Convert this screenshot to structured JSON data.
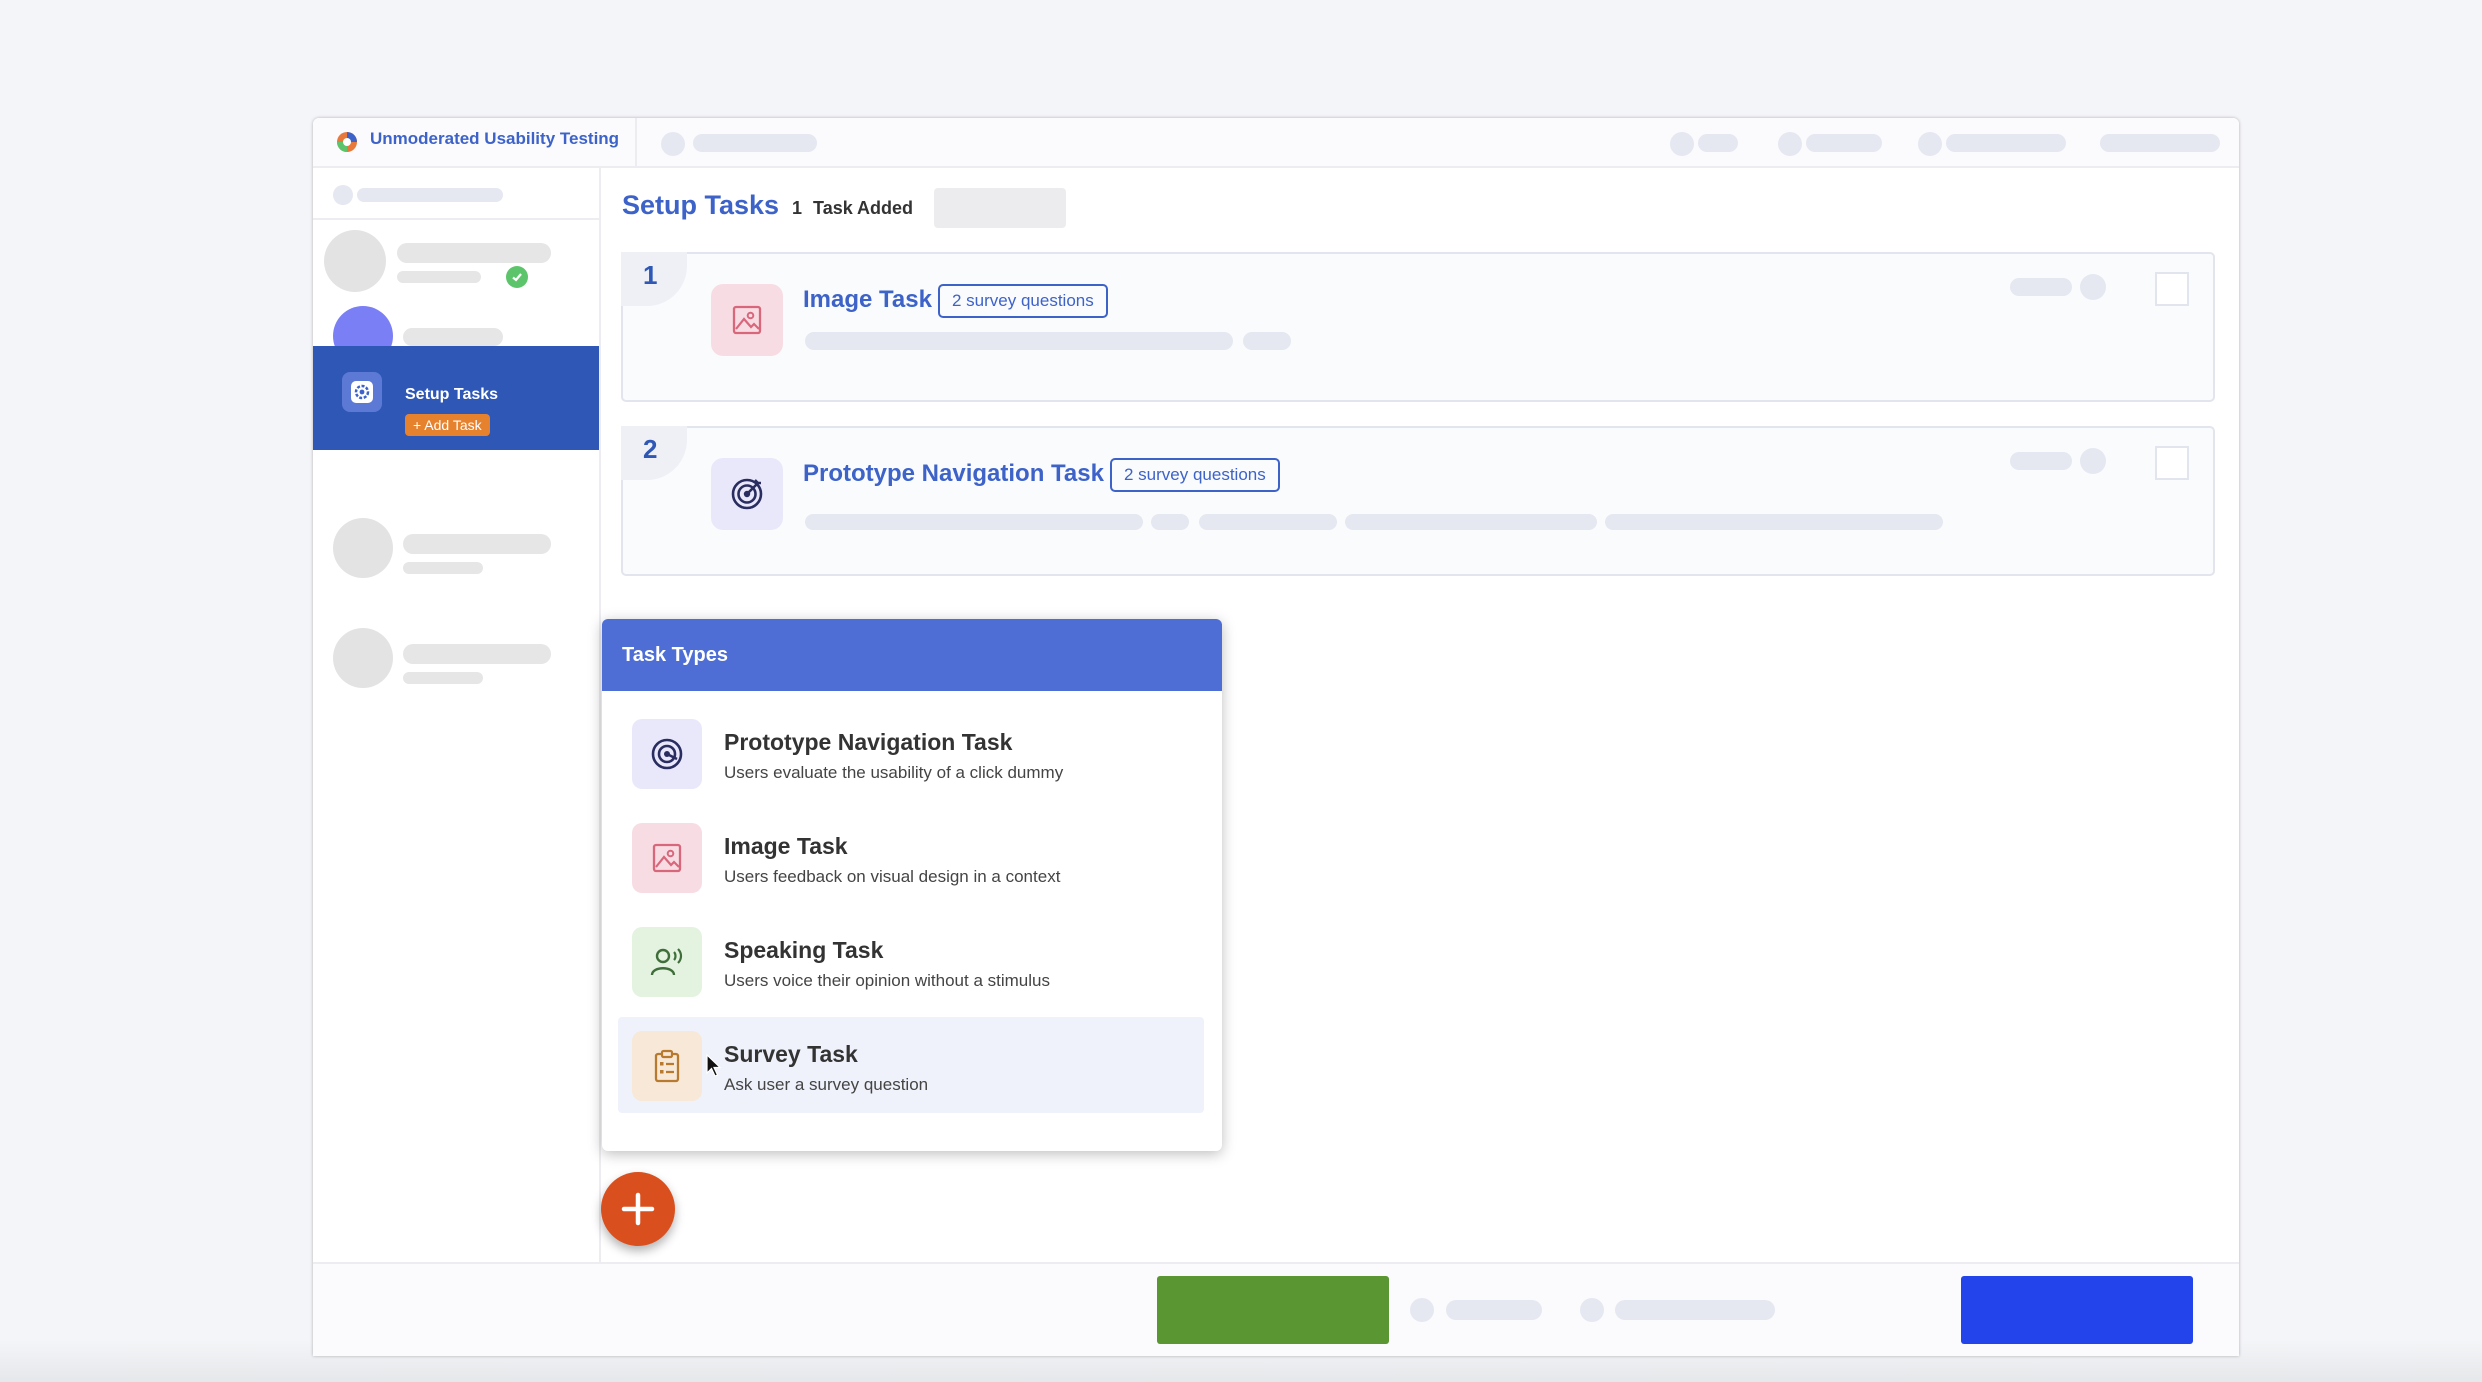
{
  "app": {
    "title": "Unmoderated Usability Testing"
  },
  "sidebar": {
    "active_step": {
      "label": "Setup Tasks",
      "add_task_label": "+ Add Task"
    }
  },
  "main": {
    "title": "Setup Tasks",
    "task_count_number": "1",
    "task_count_label": "Task Added",
    "tasks": [
      {
        "number": "1",
        "title": "Image Task",
        "tag": "2 survey questions",
        "icon": "image-icon"
      },
      {
        "number": "2",
        "title": "Prototype Navigation Task",
        "tag": "2 survey questions",
        "icon": "target-icon"
      }
    ]
  },
  "task_types": {
    "header": "Task Types",
    "items": [
      {
        "title": "Prototype Navigation Task",
        "description": "Users evaluate the usability of a click dummy",
        "icon": "target-icon",
        "color": "#e9e8fb"
      },
      {
        "title": "Image Task",
        "description": "Users feedback on visual design in a context",
        "icon": "image-icon",
        "color": "#f7dde3"
      },
      {
        "title": "Speaking Task",
        "description": "Users voice their opinion without a stimulus",
        "icon": "speaking-person-icon",
        "color": "#e3f3e0"
      },
      {
        "title": "Survey Task",
        "description": "Ask user a survey question",
        "icon": "clipboard-icon",
        "color": "#f8e8d8"
      }
    ]
  },
  "colors": {
    "accent": "#3d63c9",
    "sidebar_active": "#2e57b6",
    "add_badge": "#e6822e",
    "fab": "#d94f1e",
    "footer_green": "#5a9632",
    "footer_blue": "#2444eb"
  }
}
